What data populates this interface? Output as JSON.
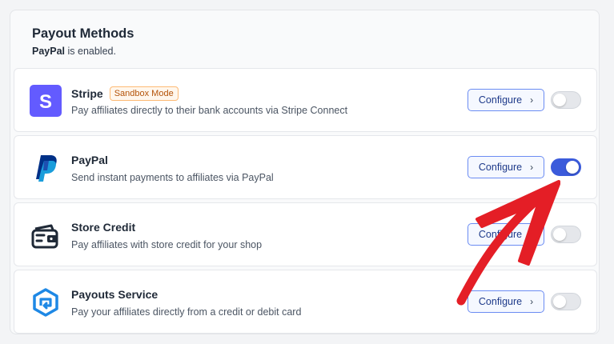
{
  "header": {
    "title": "Payout Methods",
    "status_name": "PayPal",
    "status_suffix": " is enabled."
  },
  "methods": [
    {
      "name": "Stripe",
      "badge": "Sandbox Mode",
      "description": "Pay affiliates directly to their bank accounts via Stripe Connect",
      "icon": "stripe-icon",
      "configure_label": "Configure",
      "enabled": false
    },
    {
      "name": "PayPal",
      "description": "Send instant payments to affiliates via PayPal",
      "icon": "paypal-icon",
      "configure_label": "Configure",
      "enabled": true
    },
    {
      "name": "Store Credit",
      "description": "Pay affiliates with store credit for your shop",
      "icon": "wallet-icon",
      "configure_label": "Configure",
      "enabled": false
    },
    {
      "name": "Payouts Service",
      "description": "Pay your affiliates directly from a credit or debit card",
      "icon": "payouts-service-icon",
      "configure_label": "Configure",
      "enabled": false
    }
  ],
  "colors": {
    "accent": "#3b5bdb",
    "stripe": "#635bff",
    "annotation_arrow": "#e41e26"
  }
}
